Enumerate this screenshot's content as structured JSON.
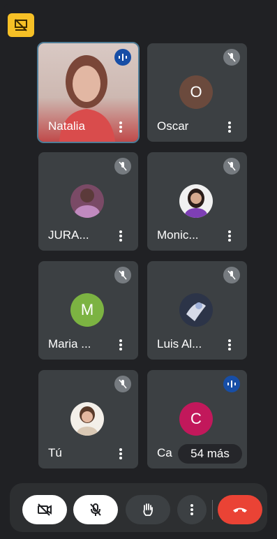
{
  "participants": [
    {
      "name": "Natalia",
      "status": "speaking",
      "avatar_type": "video",
      "avatar_letter": "",
      "avatar_color": ""
    },
    {
      "name": "Oscar",
      "status": "muted",
      "avatar_type": "letter",
      "avatar_letter": "O",
      "avatar_color": "#6b4a3d"
    },
    {
      "name": "JURA...",
      "status": "muted",
      "avatar_type": "photo",
      "avatar_letter": "",
      "avatar_color": "#7a4a66"
    },
    {
      "name": "Monic...",
      "status": "muted",
      "avatar_type": "photo",
      "avatar_letter": "",
      "avatar_color": "#b07bd0"
    },
    {
      "name": "Maria ...",
      "status": "muted",
      "avatar_type": "letter",
      "avatar_letter": "M",
      "avatar_color": "#7cb342"
    },
    {
      "name": "Luis Al...",
      "status": "muted",
      "avatar_type": "photo",
      "avatar_letter": "",
      "avatar_color": "#6a7b95"
    },
    {
      "name": "Tú",
      "status": "muted",
      "avatar_type": "photo",
      "avatar_letter": "",
      "avatar_color": "#c9a08a"
    },
    {
      "name": "Ca",
      "status": "speaking",
      "avatar_type": "letter",
      "avatar_letter": "C",
      "avatar_color": "#c2185b"
    }
  ],
  "more_participants_label": "54 más",
  "toolbar": {
    "buttons": [
      {
        "name": "camera-off-button",
        "icon": "camera-off-icon"
      },
      {
        "name": "mic-off-button",
        "icon": "mic-off-icon"
      },
      {
        "name": "raise-hand-button",
        "icon": "hand-icon"
      },
      {
        "name": "more-options-button",
        "icon": "more-vert-icon"
      },
      {
        "name": "leave-call-button",
        "icon": "phone-hangup-icon"
      }
    ]
  },
  "colors": {
    "background": "#202124",
    "tile": "#3c4043",
    "accent_yellow": "#f6c026",
    "hangup_red": "#ea4335",
    "speaking_blue": "#174ea6"
  }
}
